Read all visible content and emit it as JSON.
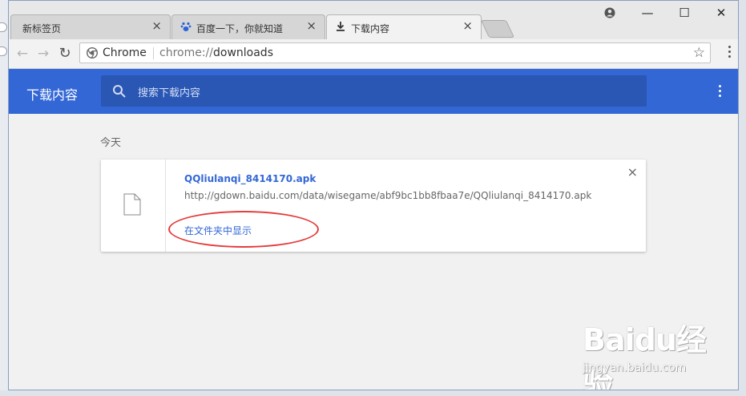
{
  "tabs": [
    {
      "title": "新标签页",
      "close": "×",
      "active": false
    },
    {
      "title": "百度一下，你就知道",
      "close": "×",
      "active": false
    },
    {
      "title": "下载内容",
      "close": "×",
      "active": true
    }
  ],
  "window_controls": {
    "minimize": "—",
    "maximize": "☐",
    "close": "✕"
  },
  "toolbar": {
    "back": "←",
    "forward": "→",
    "reload": "↻",
    "chip": "Chrome",
    "url_scheme": "chrome://",
    "url_path": "downloads",
    "star": "☆"
  },
  "header": {
    "title": "下载内容",
    "search_placeholder": "搜索下载内容"
  },
  "downloads": {
    "date_label": "今天",
    "items": [
      {
        "file_name": "QQliulanqi_8414170.apk",
        "url": "http://gdown.baidu.com/data/wisegame/abf9bc1bb8fbaa7e/QQliulanqi_8414170.apk",
        "action": "在文件夹中显示",
        "remove": "×"
      }
    ]
  },
  "watermark": {
    "logo": "Baidu经验",
    "sub": "jingyan.baidu.com"
  },
  "colors": {
    "header_bg": "#3367d6",
    "search_bg": "#2a56b4",
    "link": "#3367d6",
    "highlight": "#e53c3c"
  }
}
